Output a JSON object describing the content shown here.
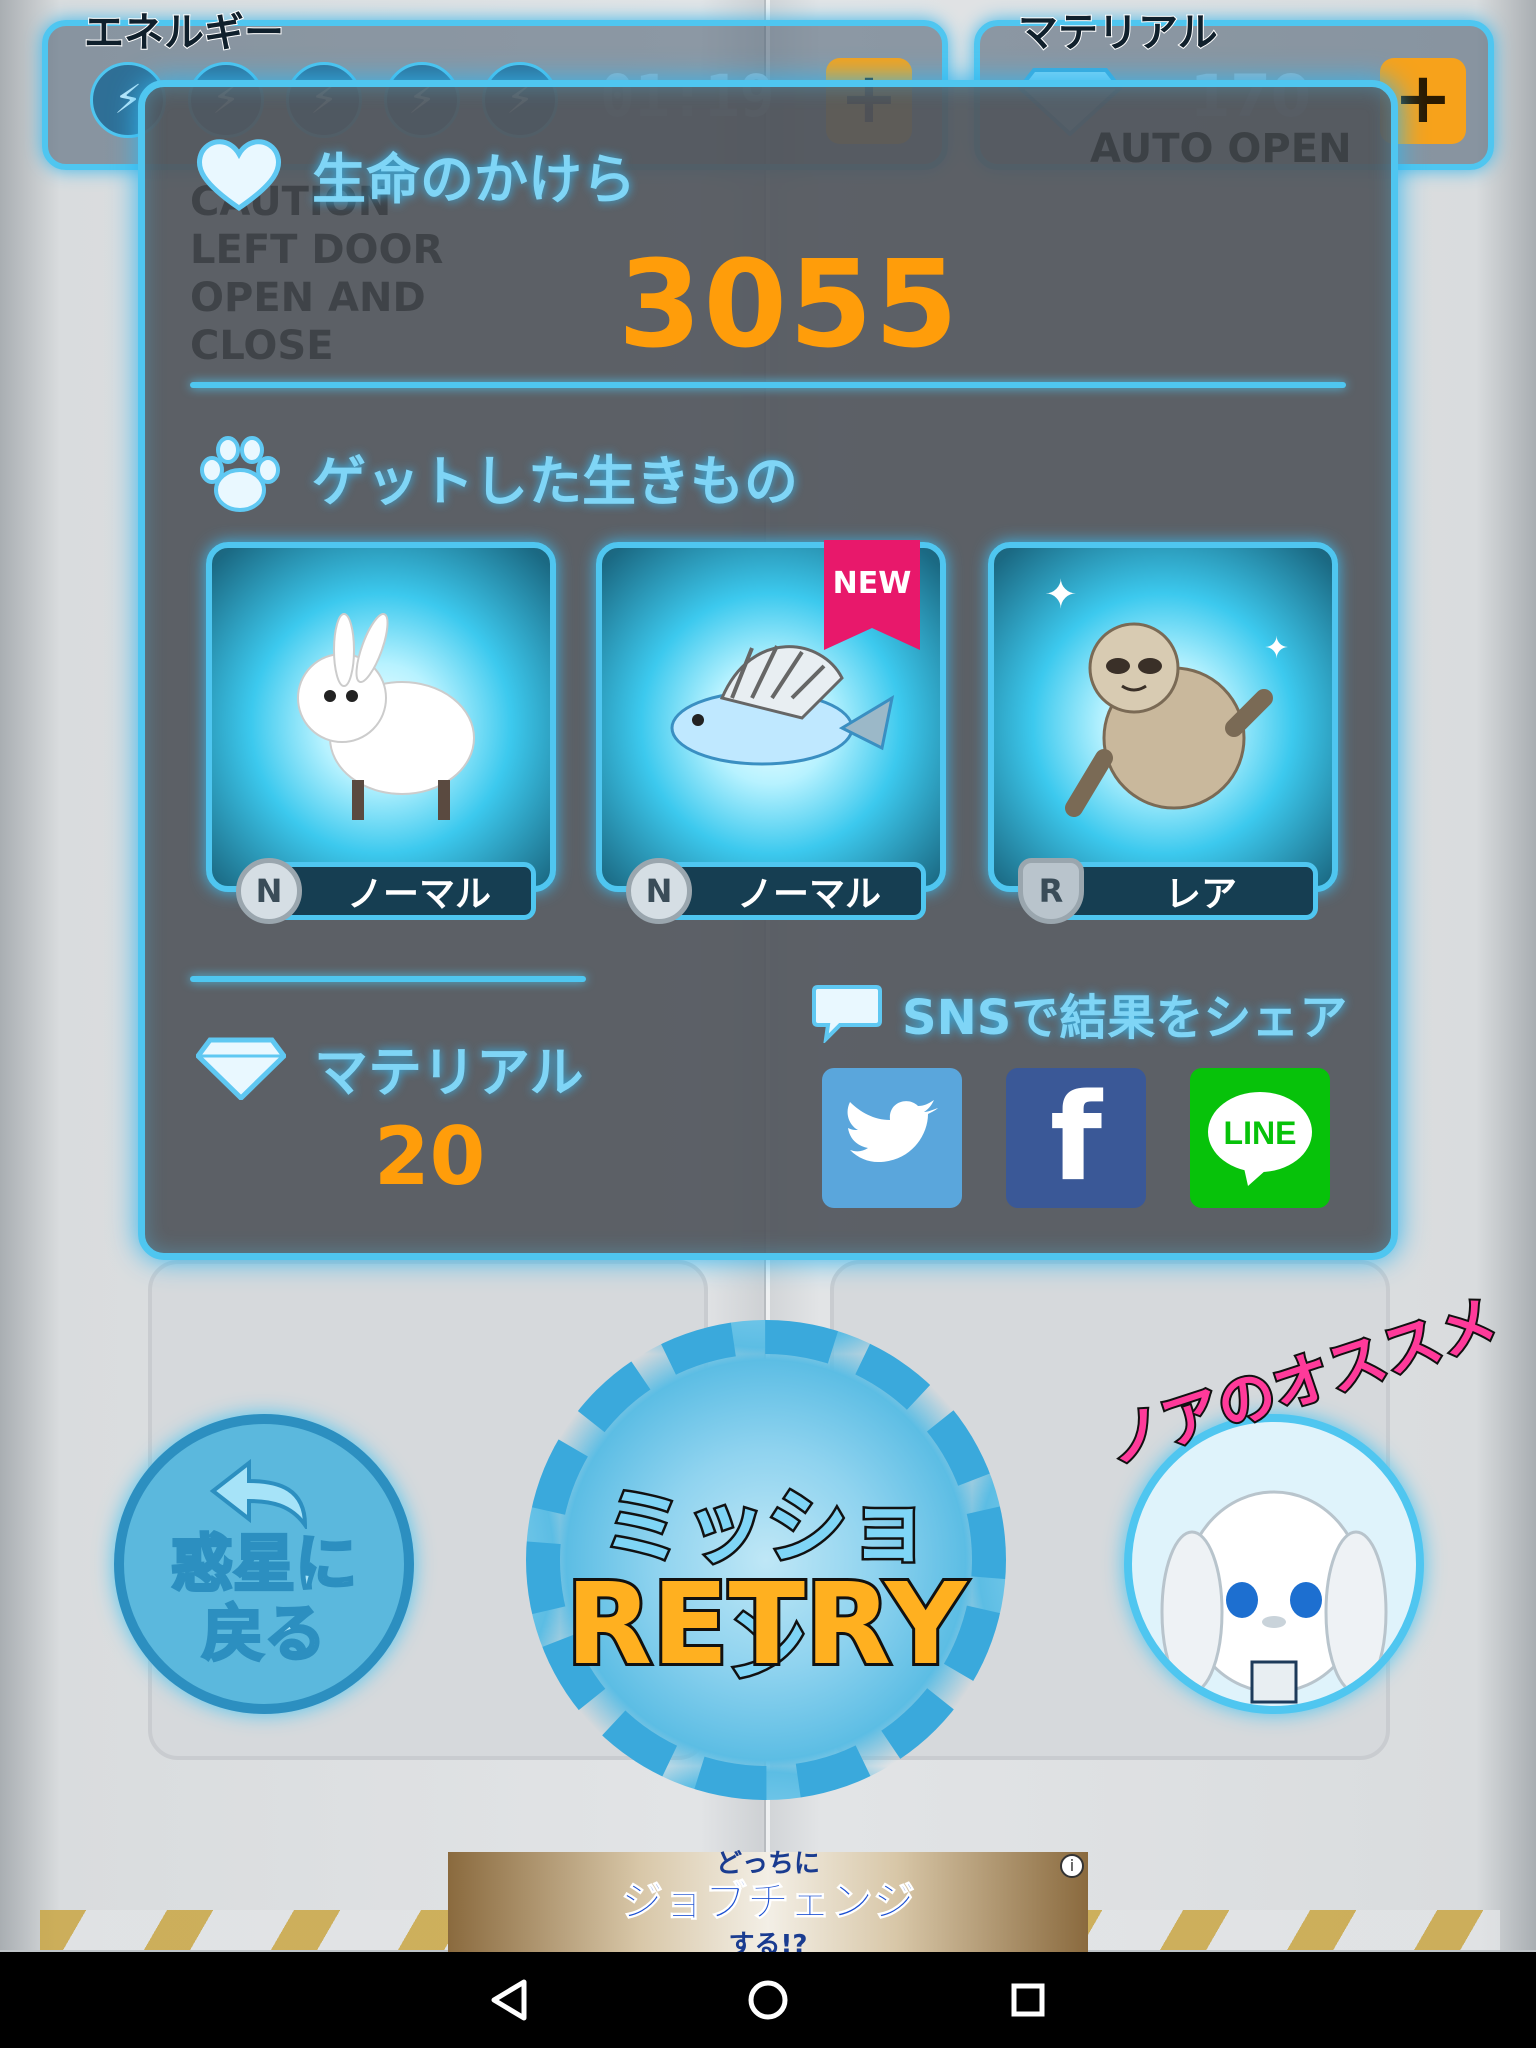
{
  "hud": {
    "energy_label": "エネルギー",
    "energy_timer": "01:19",
    "energy_slots": 5,
    "material_label": "マテリアル",
    "material_count": "170",
    "plus": "+"
  },
  "door_text": {
    "left": "CAUTION\nLEFT DOOR\nOPEN AND\nCLOSE",
    "right": "AUTO OPEN"
  },
  "result": {
    "life_title": "生命のかけら",
    "life_score": "3055",
    "creatures_title": "ゲットした生きもの",
    "creatures": [
      {
        "name": "rabbit",
        "rarity_badge": "N",
        "rarity_label": "ノーマル",
        "is_new": false
      },
      {
        "name": "fish",
        "rarity_badge": "N",
        "rarity_label": "ノーマル",
        "is_new": true
      },
      {
        "name": "sloth",
        "rarity_badge": "R",
        "rarity_label": "レア",
        "is_new": false
      }
    ],
    "new_label": "NEW",
    "material_title": "マテリアル",
    "material_gained": "20",
    "share_title": "SNSで結果をシェア",
    "share_buttons": [
      "twitter",
      "facebook",
      "LINE"
    ],
    "line_label": "LINE",
    "facebook_glyph": "f"
  },
  "controls": {
    "back_label": "惑星に\n戻る",
    "retry_sub": "ミッション",
    "retry_main": "RETRY",
    "recommend_label": "ノアのオススメ"
  },
  "ad": {
    "line1": "どっちに",
    "line2": "ジョブチェンジ",
    "line3": "する!?",
    "info": "i"
  },
  "colors": {
    "accent": "#4fc6f0",
    "score": "#ff9d0a",
    "panel": "#52565c",
    "new_ribbon": "#e8186b"
  }
}
